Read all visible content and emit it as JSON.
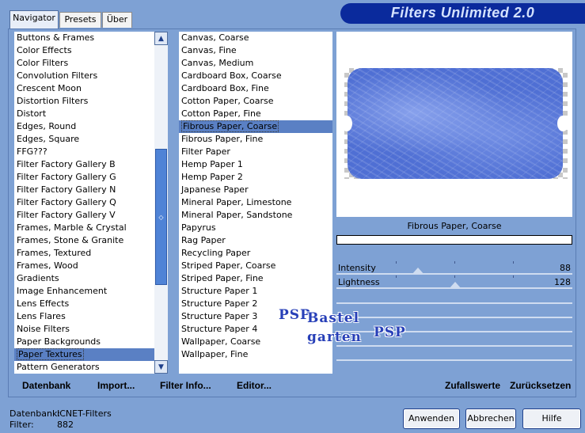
{
  "tabs": [
    {
      "label": "Navigator",
      "active": true
    },
    {
      "label": "Presets",
      "active": false
    },
    {
      "label": "Über",
      "active": false
    }
  ],
  "app_title": "Filters Unlimited 2.0",
  "categories": [
    "Buttons & Frames",
    "Color Effects",
    "Color Filters",
    "Convolution Filters",
    "Crescent Moon",
    "Distortion Filters",
    "Distort",
    "Edges, Round",
    "Edges, Square",
    "FFG???",
    "Filter Factory Gallery B",
    "Filter Factory Gallery G",
    "Filter Factory Gallery N",
    "Filter Factory Gallery Q",
    "Filter Factory Gallery V",
    "Frames, Marble & Crystal",
    "Frames, Stone & Granite",
    "Frames, Textured",
    "Frames, Wood",
    "Gradients",
    "Image Enhancement",
    "Lens Effects",
    "Lens Flares",
    "Noise Filters",
    "Paper Backgrounds",
    "Paper Textures",
    "Pattern Generators"
  ],
  "selected_category": "Paper Textures",
  "filters": [
    "Canvas, Coarse",
    "Canvas, Fine",
    "Canvas, Medium",
    "Cardboard Box, Coarse",
    "Cardboard Box, Fine",
    "Cotton Paper, Coarse",
    "Cotton Paper, Fine",
    "Fibrous Paper, Coarse",
    "Fibrous Paper, Fine",
    "Filter Paper",
    "Hemp Paper 1",
    "Hemp Paper 2",
    "Japanese Paper",
    "Mineral Paper, Limestone",
    "Mineral Paper, Sandstone",
    "Papyrus",
    "Rag Paper",
    "Recycling Paper",
    "Striped Paper, Coarse",
    "Striped Paper, Fine",
    "Structure Paper 1",
    "Structure Paper 2",
    "Structure Paper 3",
    "Structure Paper 4",
    "Wallpaper, Coarse",
    "Wallpaper, Fine"
  ],
  "selected_filter": "Fibrous Paper, Coarse",
  "preview": {
    "filter_name": "Fibrous Paper, Coarse",
    "texture_color": "#4f6fd4"
  },
  "sliders": [
    {
      "label": "Intensity",
      "value": "88",
      "level": 88
    },
    {
      "label": "Lightness",
      "value": "128",
      "level": 128
    }
  ],
  "left_toolbar": {
    "database": "Datenbank",
    "import": "Import...",
    "filter_info": "Filter Info...",
    "editor": "Editor..."
  },
  "right_toolbar": {
    "random": "Zufallswerte",
    "reset": "Zurücksetzen"
  },
  "status": {
    "db_label": "Datenbank:",
    "db_value": "ICNET-Filters",
    "filter_label": "Filter:",
    "filter_value": "882"
  },
  "buttons": {
    "apply": "Anwenden",
    "cancel": "Abbrechen",
    "help": "Hilfe"
  },
  "watermark": {
    "line1": "Bastel",
    "line2": "garten",
    "logo": "PSP"
  },
  "colors": {
    "background": "#7ea1d4",
    "banner": "#0a2a9c",
    "selection": "#5a80c4"
  }
}
